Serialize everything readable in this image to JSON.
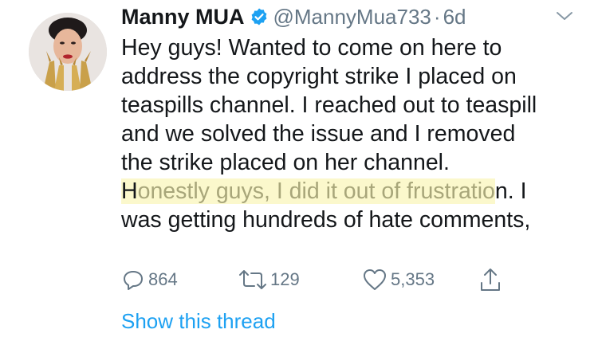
{
  "author": {
    "display_name": "Manny MUA",
    "handle": "@MannyMua733",
    "separator": "·",
    "time": "6d",
    "avatar_icon": "avatar-photo",
    "verified_icon": "verified-badge-icon"
  },
  "tweet": {
    "lines": [
      "Hey guys! Wanted to come on here to",
      "address the copyright strike I placed on",
      "teaspills channel. I reached out to teaspill",
      "and we solved the issue and I removed",
      "the strike placed on her channel."
    ],
    "highlight_line": {
      "first_char": "H",
      "highlighted": "onestly guys, I did it out of frustratio",
      "rest": "n. I"
    },
    "last_line": "was getting hundreds of hate comments,"
  },
  "actions": {
    "replies": "864",
    "retweets": "129",
    "likes": "5,353"
  },
  "show_thread": "Show this thread",
  "colors": {
    "accent": "#1da1f2",
    "muted": "#657786",
    "text": "#14171a",
    "highlight": "#fbf8cc"
  }
}
